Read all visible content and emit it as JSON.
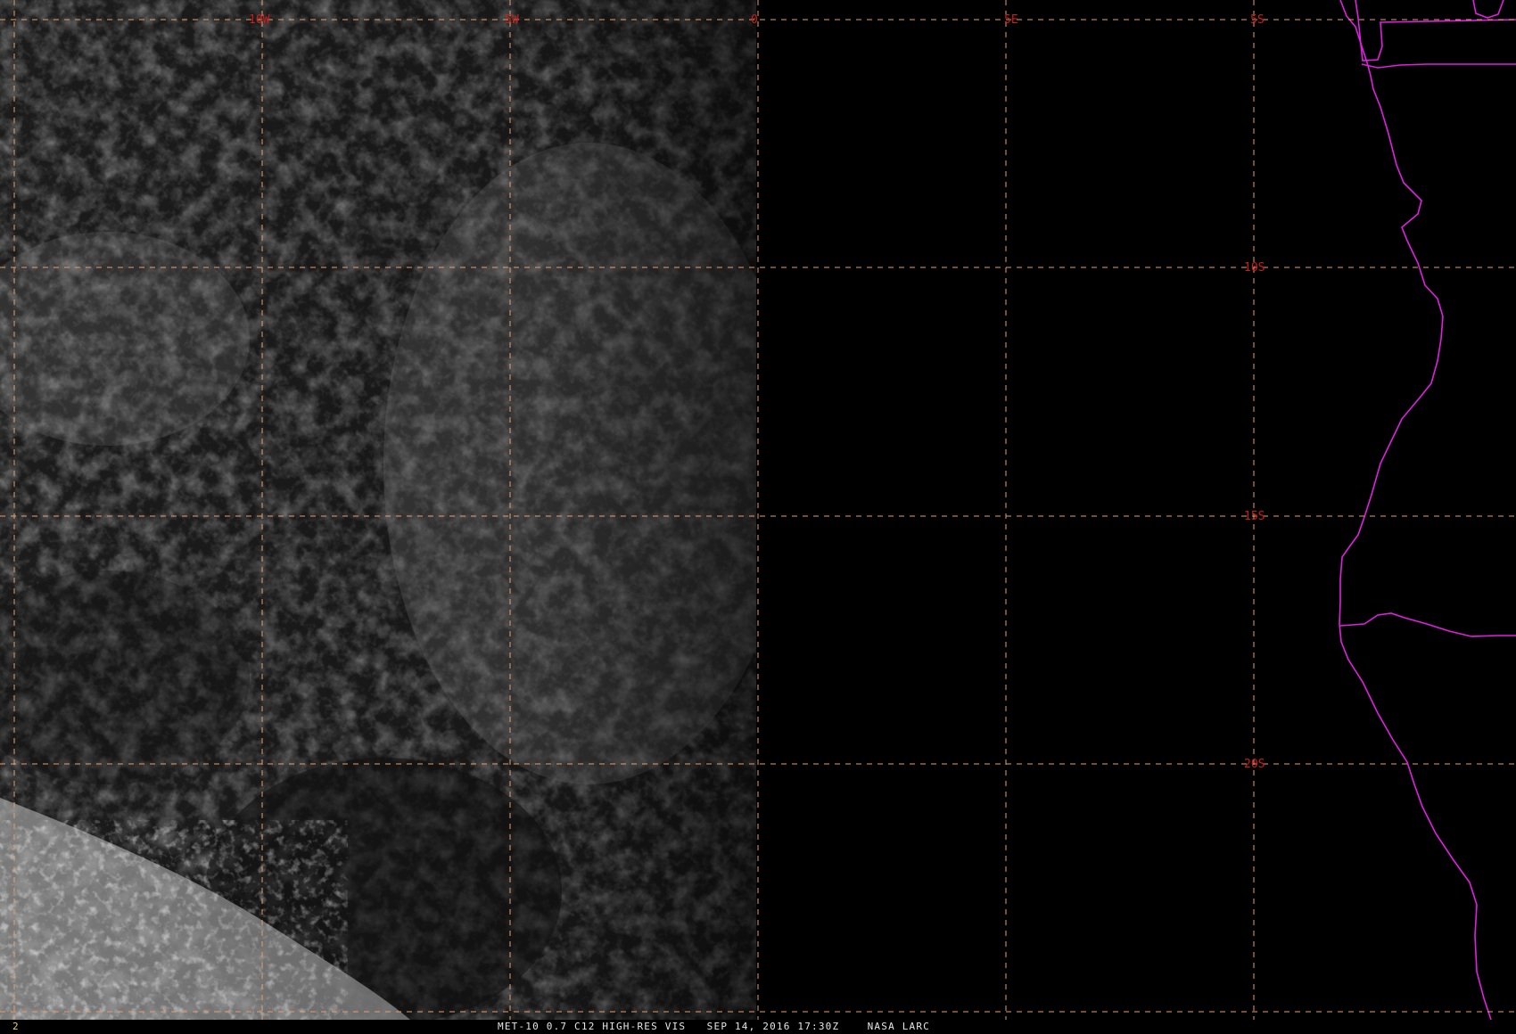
{
  "map": {
    "projection": "geostationary lat/lon grid",
    "colors": {
      "gridline": "#e6a06a",
      "grid_label": "#c81e1e",
      "coastline": "#e020e0",
      "caption_text": "#e6e6e6",
      "frame_number": "#e8d84a",
      "background": "#000000"
    },
    "longitude_labels": [
      "10W",
      "5W",
      "0",
      "5E",
      "5S"
    ],
    "latitude_labels": [
      "10S",
      "15S",
      "20S"
    ]
  },
  "status_bar": {
    "frame_number": "2",
    "caption": "MET-10 0.7 C12 HIGH-RES VIS   SEP 14, 2016 17:30Z    NASA LARC"
  }
}
